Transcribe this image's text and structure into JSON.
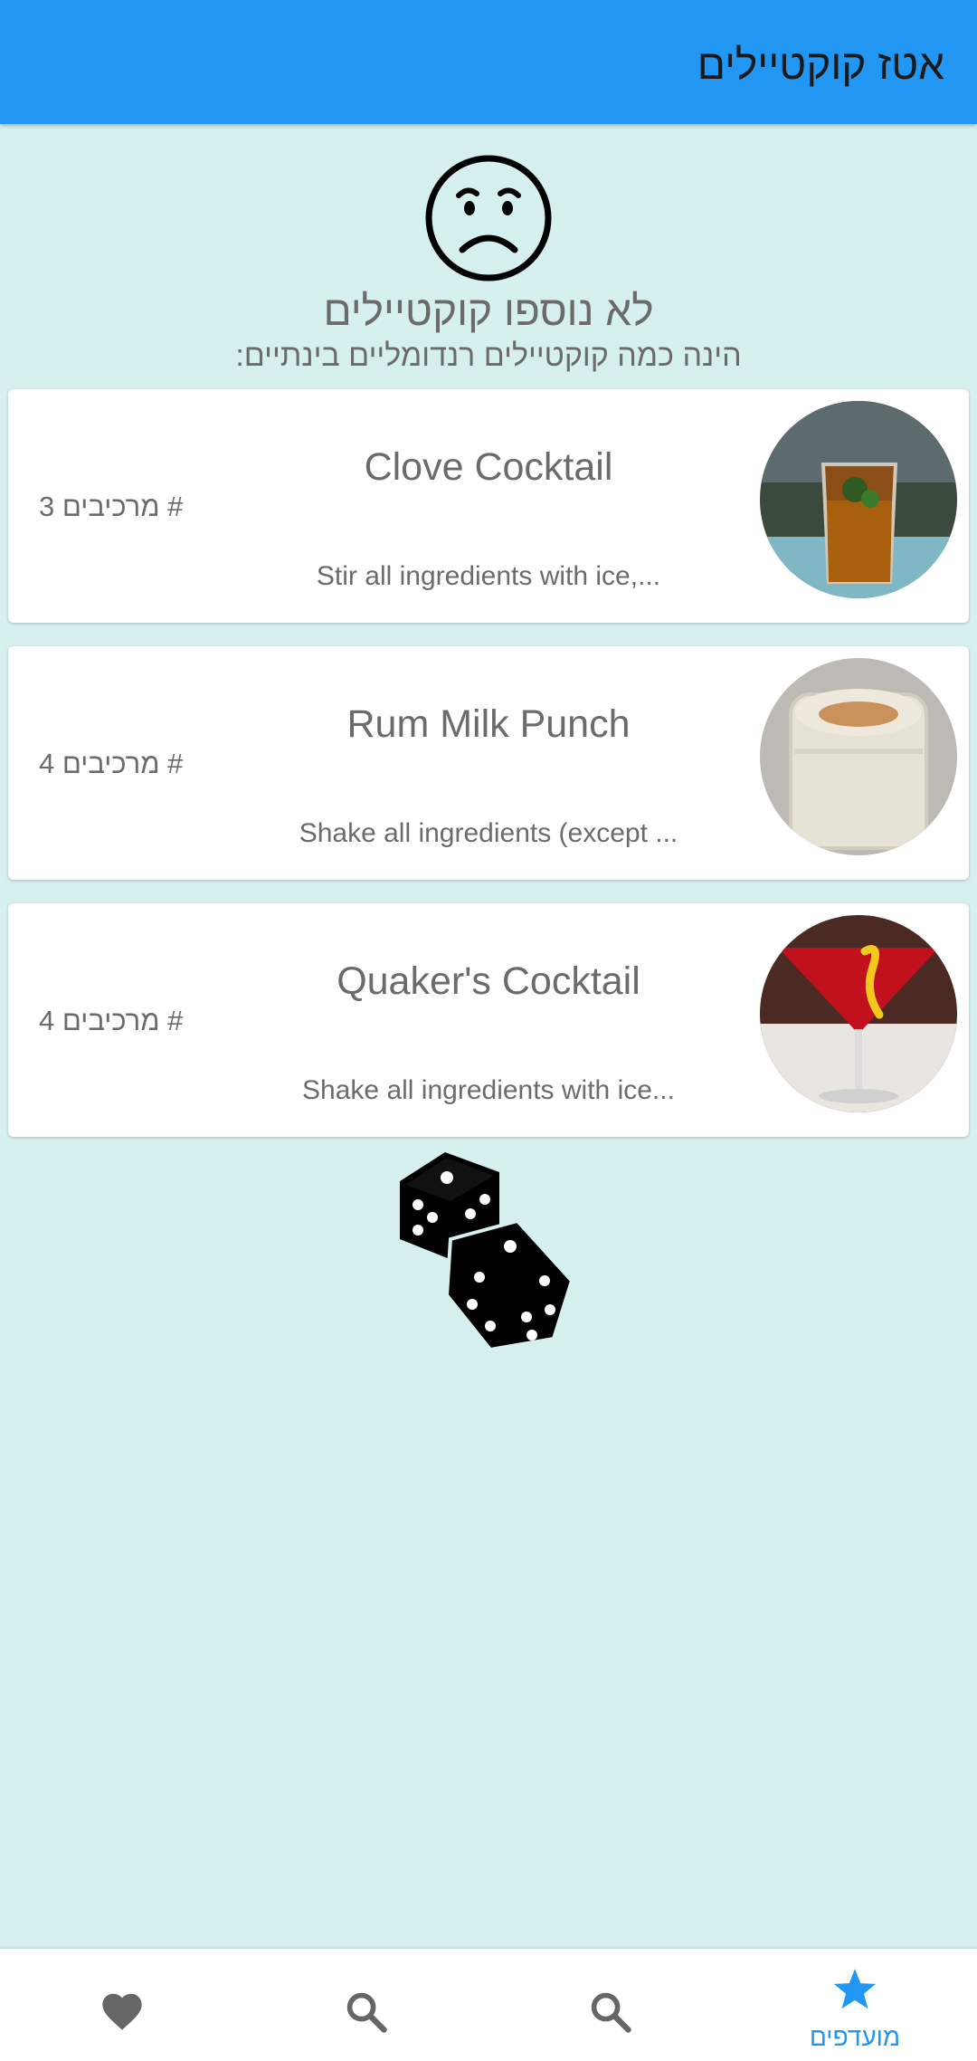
{
  "appbar": {
    "title": "אטז קוקטיילים"
  },
  "empty_state": {
    "icon": "sad-face-icon",
    "title": "לא נוספו קוקטיילים",
    "subtitle": "הינה כמה קוקטיילים רנדומליים בינתיים:"
  },
  "cocktails": [
    {
      "name": "Clove Cocktail",
      "count": "# מרכיבים 3",
      "description": "Stir all ingredients with ice,..."
    },
    {
      "name": "Rum Milk Punch",
      "count": "# מרכיבים 4",
      "description": "Shake all ingredients (except ..."
    },
    {
      "name": "Quaker's Cocktail",
      "count": "# מרכיבים 4",
      "description": "Shake all ingredients with ice..."
    }
  ],
  "random_button": {
    "icon": "dice-icon"
  },
  "bottom_nav": {
    "items": [
      {
        "icon": "heart-icon",
        "label": ""
      },
      {
        "icon": "search-icon",
        "label": ""
      },
      {
        "icon": "search-icon",
        "label": ""
      },
      {
        "icon": "star-icon",
        "label": "מועדפים"
      }
    ]
  },
  "colors": {
    "primary": "#2196f3",
    "background": "#d6efef",
    "text_muted": "#6b6b6b",
    "nav_inactive": "#666666"
  }
}
